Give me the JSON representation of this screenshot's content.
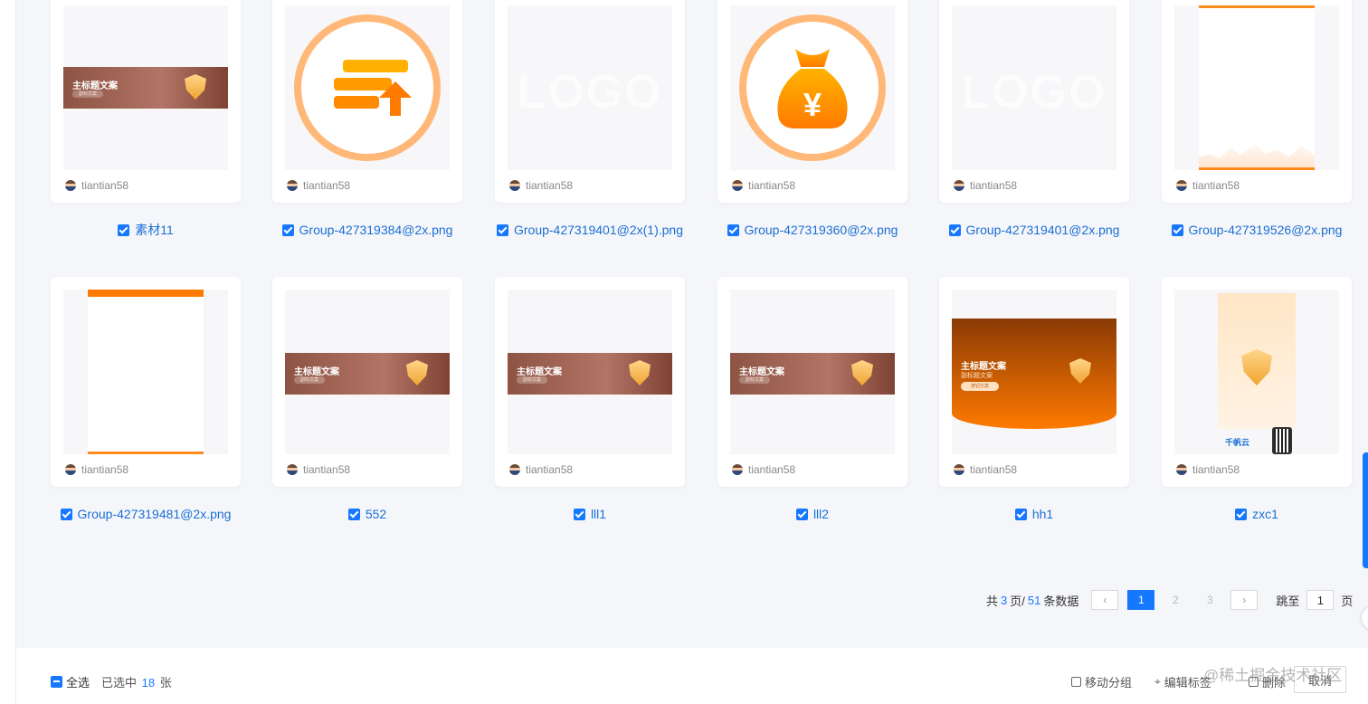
{
  "assets": [
    {
      "name": "素材11",
      "owner": "tiantian58",
      "thumb": "banner-brown-top"
    },
    {
      "name": "Group-427319384@2x.png",
      "owner": "tiantian58",
      "thumb": "upload-icon"
    },
    {
      "name": "Group-427319401@2x(1).png",
      "owner": "tiantian58",
      "thumb": "logo"
    },
    {
      "name": "Group-427319360@2x.png",
      "owner": "tiantian58",
      "thumb": "money-bag-icon"
    },
    {
      "name": "Group-427319401@2x.png",
      "owner": "tiantian58",
      "thumb": "logo"
    },
    {
      "name": "Group-427319526@2x.png",
      "owner": "tiantian58",
      "thumb": "city-skyline"
    },
    {
      "name": "Group-427319481@2x.png",
      "owner": "tiantian58",
      "thumb": "blank-page"
    },
    {
      "name": "552",
      "owner": "tiantian58",
      "thumb": "banner-brown"
    },
    {
      "name": "lll1",
      "owner": "tiantian58",
      "thumb": "banner-brown"
    },
    {
      "name": "lll2",
      "owner": "tiantian58",
      "thumb": "banner-brown"
    },
    {
      "name": "hh1",
      "owner": "tiantian58",
      "thumb": "banner-orange"
    },
    {
      "name": "zxc1",
      "owner": "tiantian58",
      "thumb": "poster-shield"
    }
  ],
  "banner_text": {
    "title": "主标题文案",
    "subtitle": "副标题文案",
    "button": "按钮文案",
    "small": "副标文案"
  },
  "thumb_text": {
    "logo": "LOGO",
    "brand": "千帆云",
    "currency": "¥"
  },
  "pagination": {
    "prefix": "共",
    "total_pages": "3",
    "pages_suffix": "页/",
    "total_items": "51",
    "items_suffix": "条数据",
    "prev": "‹",
    "next": "›",
    "pages": [
      "1",
      "2",
      "3"
    ],
    "current": "1",
    "jump_label": "跳至",
    "jump_value": "1",
    "jump_suffix": "页"
  },
  "bottom_bar": {
    "select_all": "全选",
    "selected_prefix": "已选中",
    "selected_count": "18",
    "selected_suffix": "张",
    "move_group": "移动分组",
    "edit_tag": "编辑标签",
    "delete": "删除",
    "cancel": "取消"
  },
  "watermark": "@稀土掘金技术社区",
  "colors": {
    "accent": "#1677ff",
    "link_text": "#1a6fd4",
    "orange": "#ff8a1c",
    "brown": "#8d5443"
  }
}
